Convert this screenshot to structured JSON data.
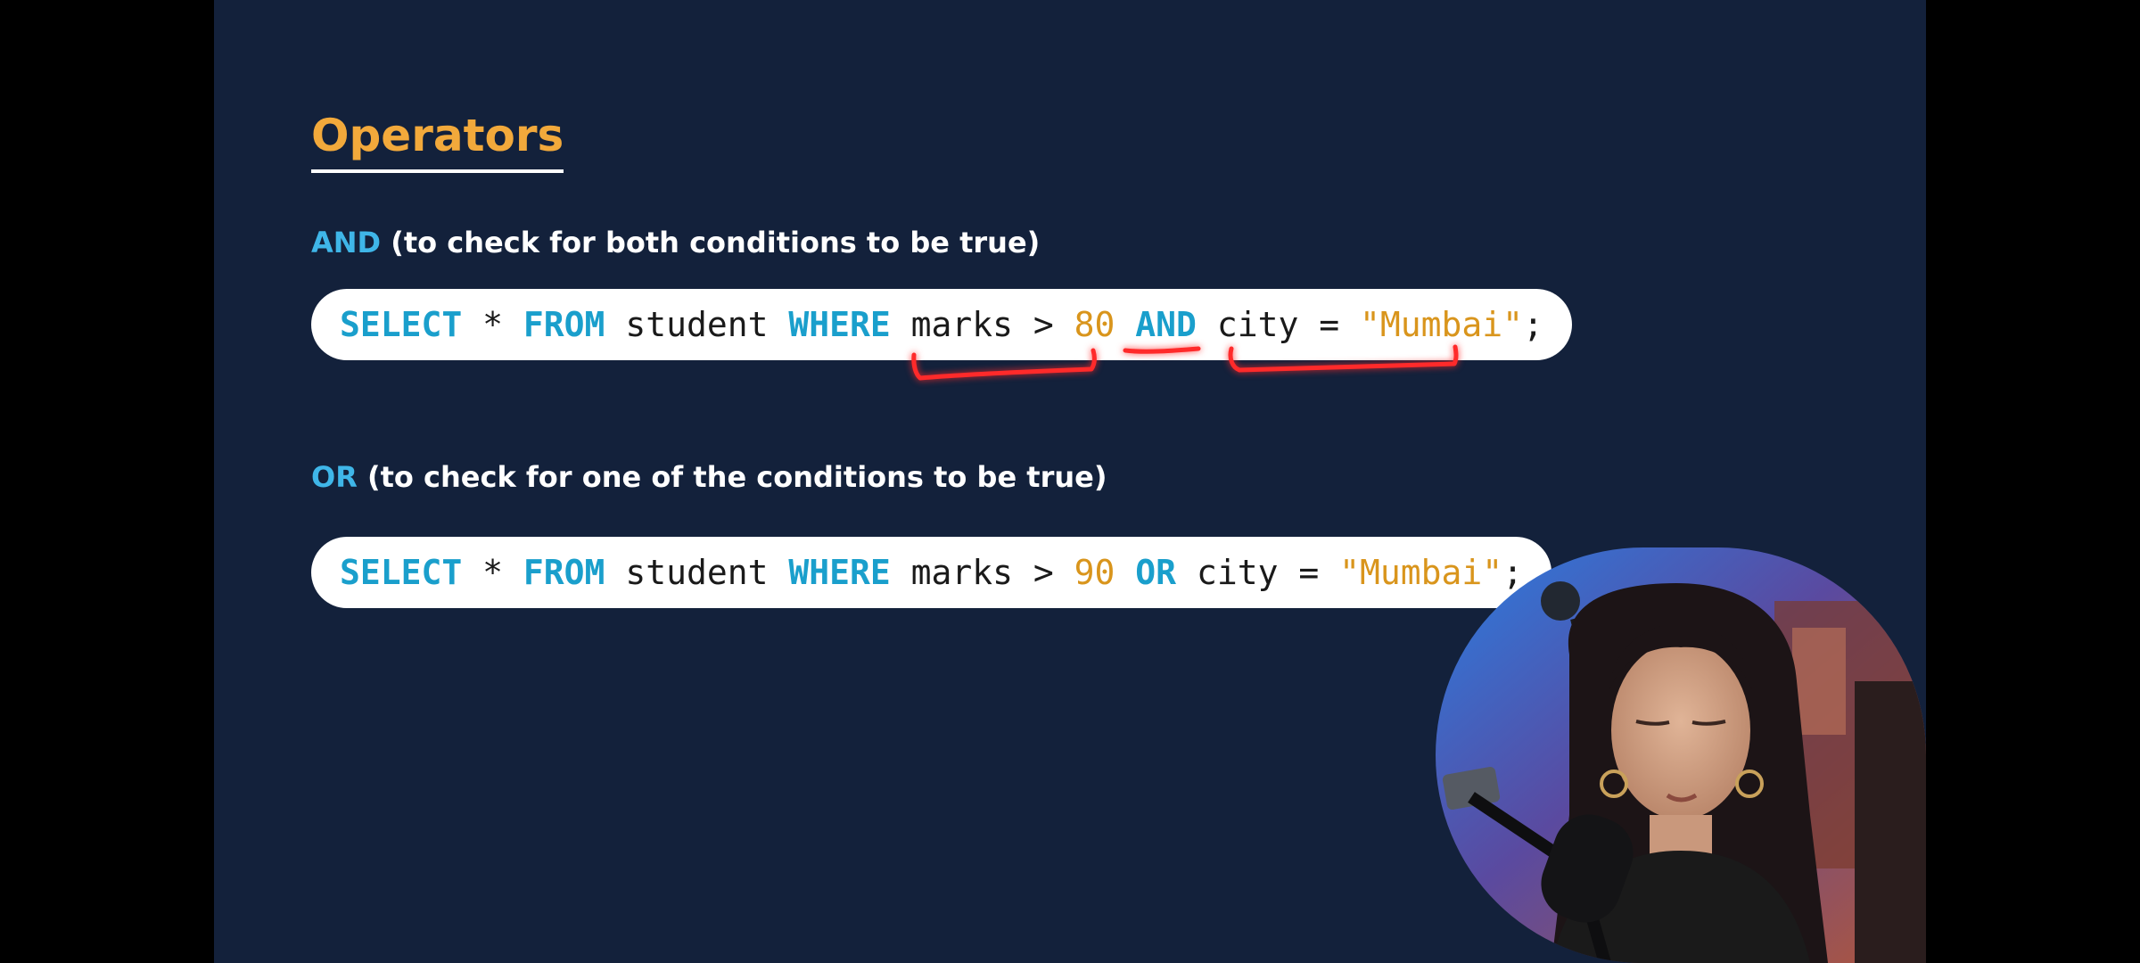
{
  "slide": {
    "title": "Operators",
    "and_section": {
      "keyword": "AND",
      "description": " (to check for both conditions to be true)",
      "query": {
        "select": "SELECT",
        "star": " * ",
        "from": "FROM",
        "table": " student ",
        "where": "WHERE",
        "condition1": " marks > ",
        "value1": "80",
        "space1": " ",
        "operator": "AND",
        "condition2": " city = ",
        "value2": "\"Mumbai\"",
        "end": ";"
      }
    },
    "or_section": {
      "keyword": "OR",
      "description": " (to check for one of the conditions to be true)",
      "query": {
        "select": "SELECT",
        "star": " * ",
        "from": "FROM",
        "table": " student ",
        "where": "WHERE",
        "condition1": " marks > ",
        "value1": "90",
        "space1": " ",
        "operator": "OR",
        "condition2": " city = ",
        "value2": "\"Mumbai\"",
        "end": ";"
      }
    }
  },
  "colors": {
    "background": "#13213b",
    "title": "#f2a93b",
    "keyword_heading": "#3fb6e8",
    "sql_keyword": "#1a9fcc",
    "sql_value": "#d9951c",
    "annotation": "#ff2a2a"
  }
}
